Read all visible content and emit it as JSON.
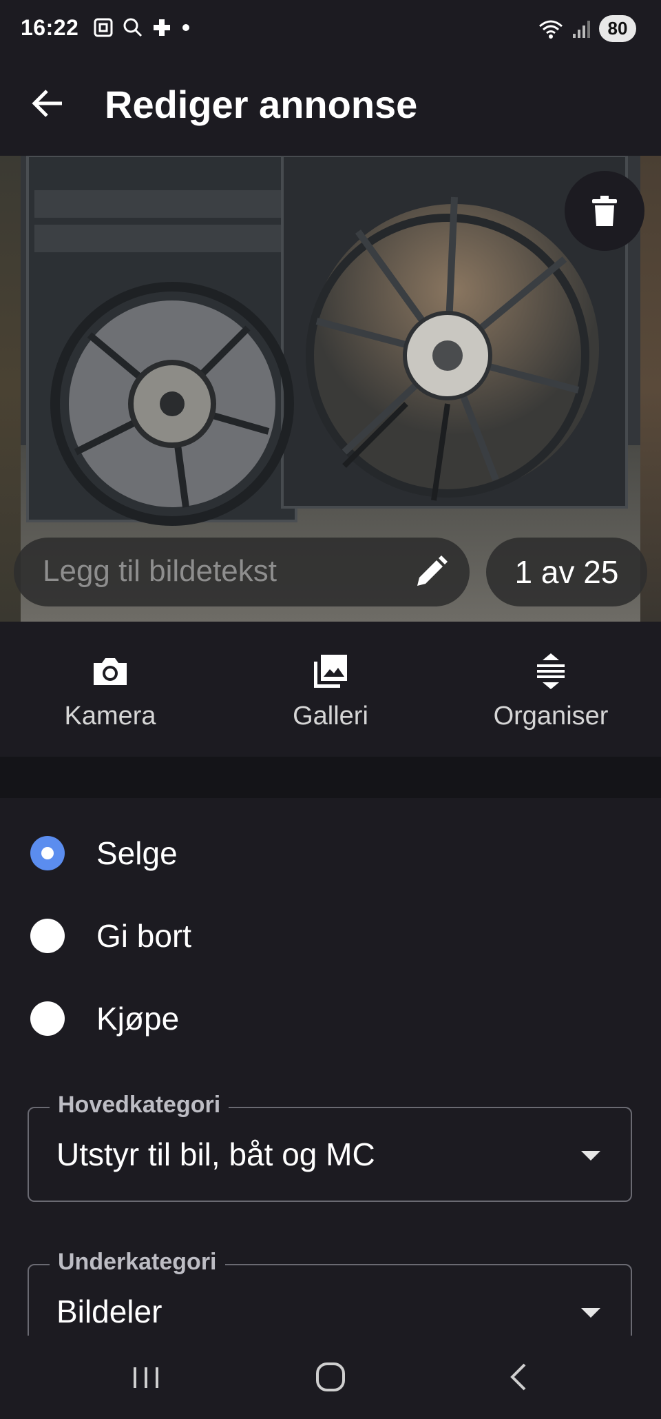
{
  "status_bar": {
    "time": "16:22",
    "battery": "80"
  },
  "header": {
    "title": "Rediger annonse"
  },
  "photo": {
    "caption_placeholder": "Legg til bildetekst",
    "counter": "1 av 25"
  },
  "toolbar": {
    "camera_label": "Kamera",
    "gallery_label": "Galleri",
    "organize_label": "Organiser"
  },
  "listing_type": {
    "options": [
      {
        "label": "Selge",
        "selected": true
      },
      {
        "label": "Gi bort",
        "selected": false
      },
      {
        "label": "Kjøpe",
        "selected": false
      }
    ]
  },
  "main_category": {
    "label": "Hovedkategori",
    "value": "Utstyr til bil, båt og MC"
  },
  "sub_category": {
    "label": "Underkategori",
    "value": "Bildeler"
  },
  "colors": {
    "background": "#1c1b21",
    "accent": "#5b8def",
    "divider": "#141418"
  },
  "icons": [
    "screenshot-icon",
    "search-icon",
    "plus-icon",
    "wifi-icon",
    "signal-icon",
    "back-arrow-icon",
    "trash-icon",
    "pencil-icon",
    "camera-icon",
    "gallery-icon",
    "organize-icon",
    "recents-icon",
    "home-icon",
    "nav-back-icon"
  ]
}
